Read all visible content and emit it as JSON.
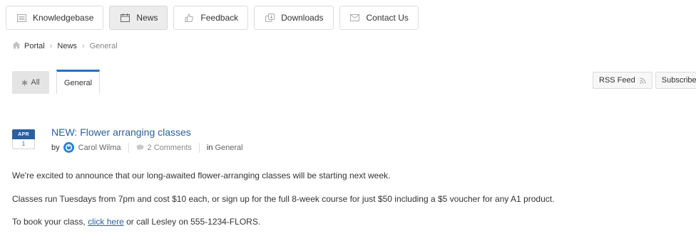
{
  "nav": {
    "items": [
      {
        "label": "Knowledgebase",
        "icon": "knowledgebase-icon",
        "active": false
      },
      {
        "label": "News",
        "icon": "calendar-icon",
        "active": true
      },
      {
        "label": "Feedback",
        "icon": "thumbs-up-icon",
        "active": false
      },
      {
        "label": "Downloads",
        "icon": "downloads-icon",
        "active": false
      },
      {
        "label": "Contact Us",
        "icon": "envelope-icon",
        "active": false
      }
    ]
  },
  "breadcrumb": {
    "items": [
      "Portal",
      "News",
      "General"
    ],
    "separator": "›"
  },
  "tabs": {
    "all_label": "All",
    "general_label": "General"
  },
  "actions": {
    "rss_label": "RSS Feed",
    "subscribe_label": "Subscribe"
  },
  "article": {
    "date_month": "APR",
    "date_day": "1",
    "title": "NEW: Flower arranging classes",
    "by_label": "by",
    "author": "Carol Wilma",
    "comments": "2 Comments",
    "category_prefix": "in",
    "category": "General",
    "paragraphs": {
      "p1": "We're excited to announce that our long-awaited flower-arranging classes will be starting next week.",
      "p2": "Classes run Tuesdays from 7pm and cost $10 each, or sign up for the full 8-week course for just $50 including a $5 voucher for any A1 product.",
      "p3_before": "To book your class, ",
      "p3_link": "click here",
      "p3_after": " or call Lesley on 555-1234-FLORS."
    }
  },
  "colors": {
    "accent": "#2a5fa0",
    "tab_border": "#2a6fb5",
    "avatar": "#1a87d6"
  }
}
